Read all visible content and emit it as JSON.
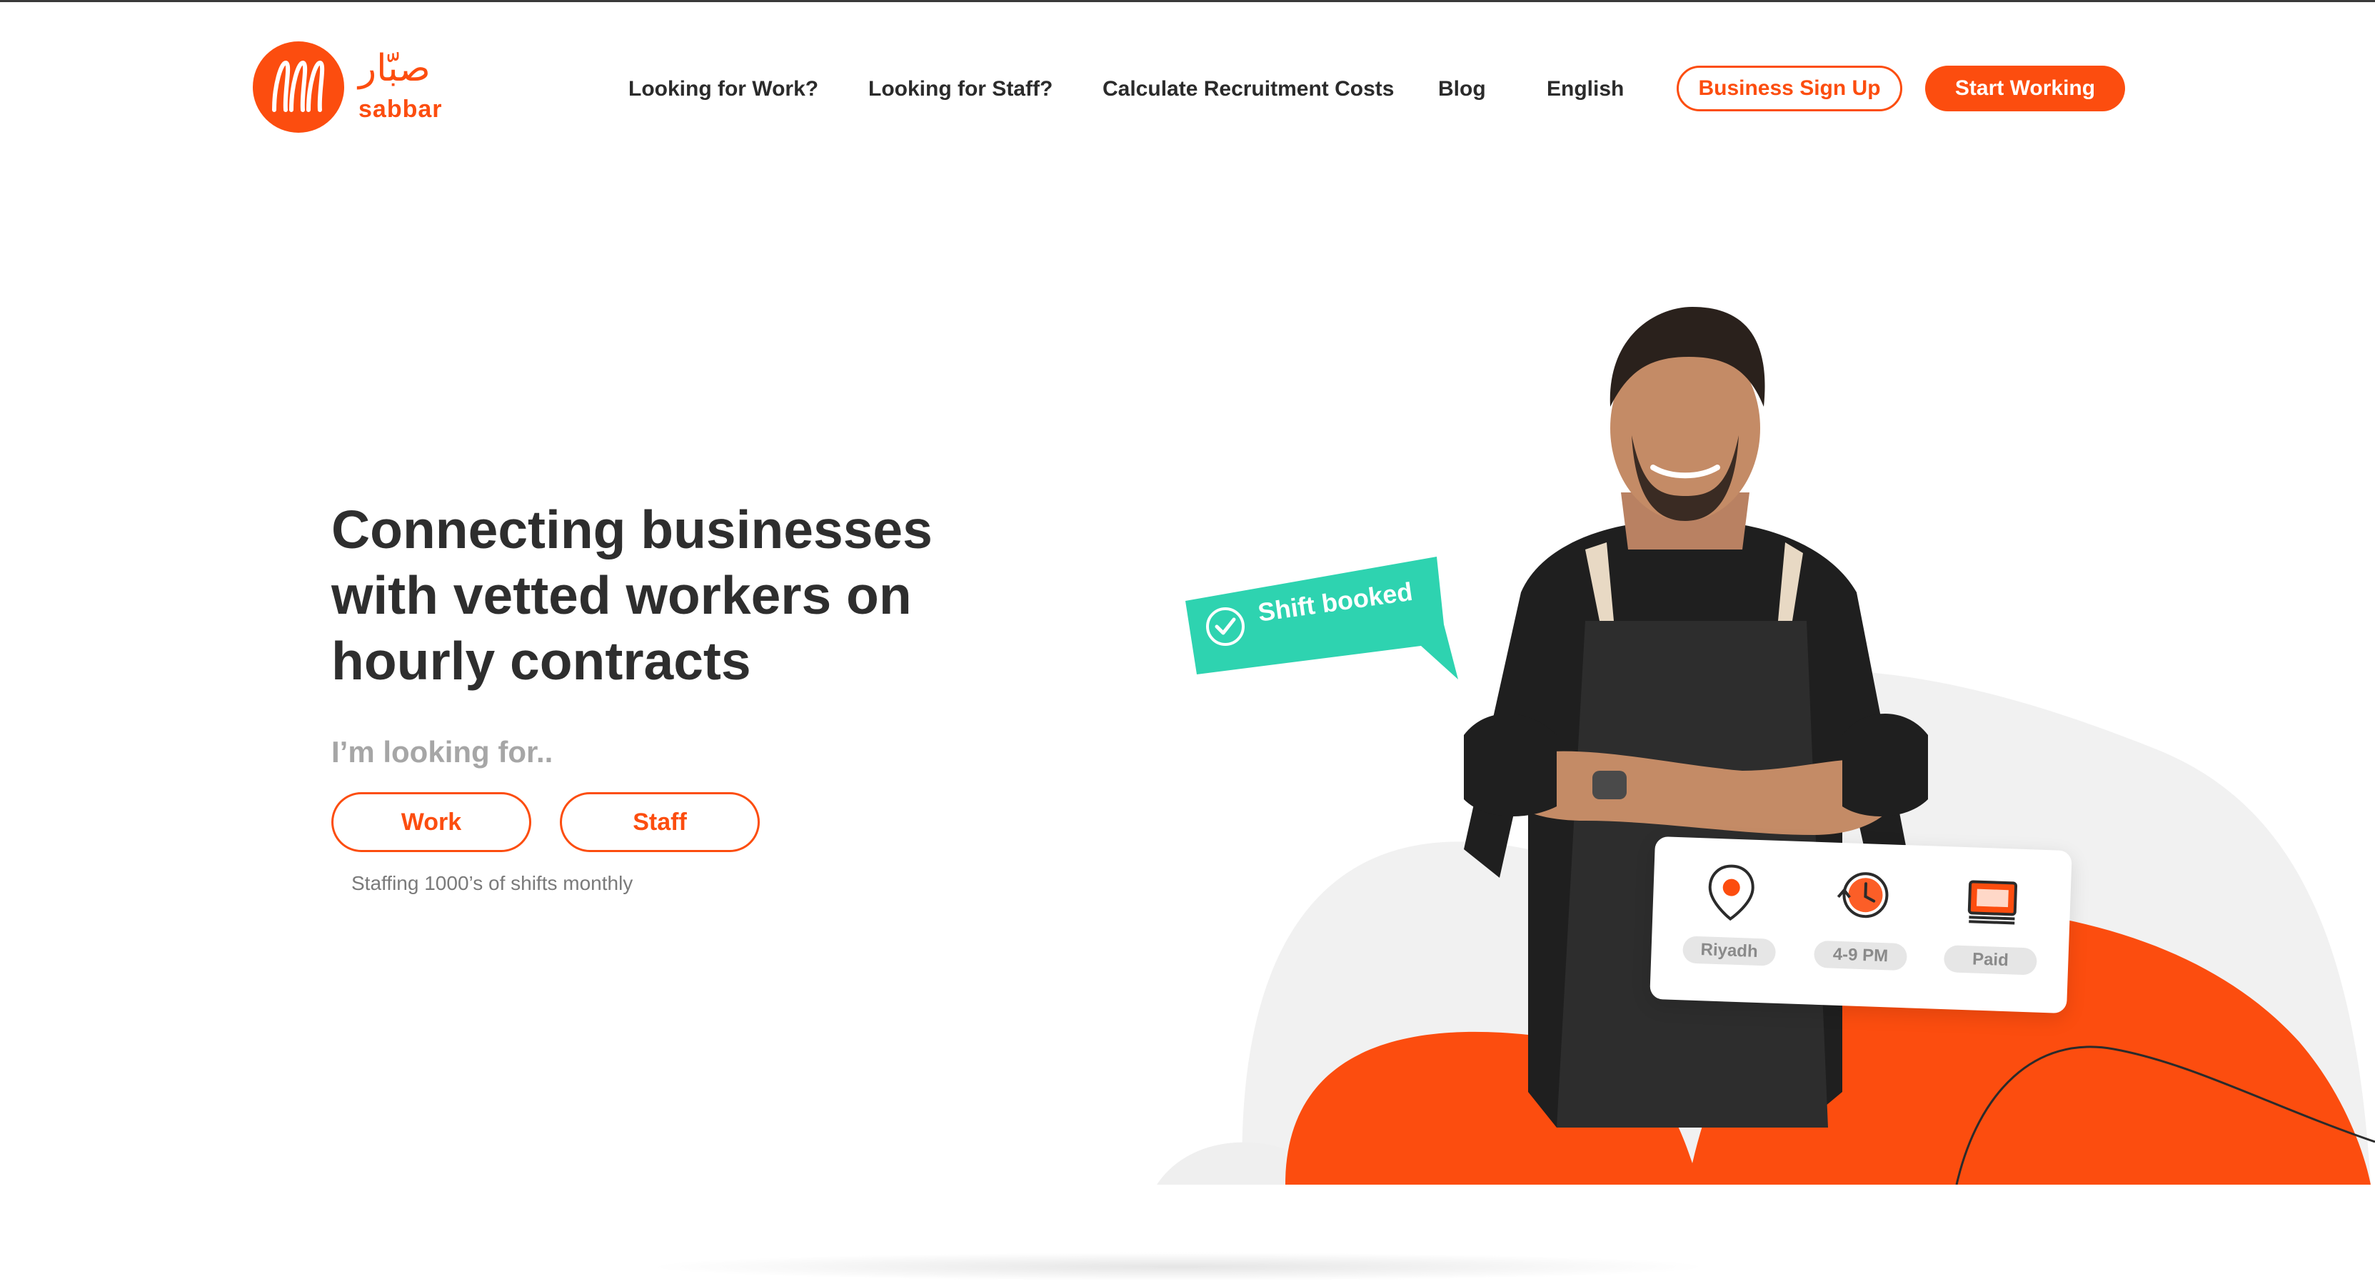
{
  "brand": {
    "arabic": "صبّار",
    "latin": "sabbar",
    "accent": "#fc4d0f",
    "secondary": "#2ed3b0"
  },
  "nav": {
    "items": [
      "Looking for Work?",
      "Looking for Staff?",
      "Calculate Recruitment Costs",
      "Blog",
      "English"
    ],
    "business_signup": "Business Sign Up",
    "start_working": "Start Working"
  },
  "hero": {
    "headline_lines": [
      "Connecting businesses",
      "with vetted workers on",
      "hourly contracts"
    ],
    "looking_for": "I’m looking for..",
    "work_button": "Work",
    "staff_button": "Staff",
    "stat": "Staffing 1000’s of shifts monthly"
  },
  "illustration": {
    "badge": "Shift booked",
    "card": {
      "location": "Riyadh",
      "time": "4-9 PM",
      "payment": "Paid"
    },
    "icons": [
      "location-pin-icon",
      "clock-icon",
      "money-icon",
      "check-circle-icon"
    ]
  }
}
